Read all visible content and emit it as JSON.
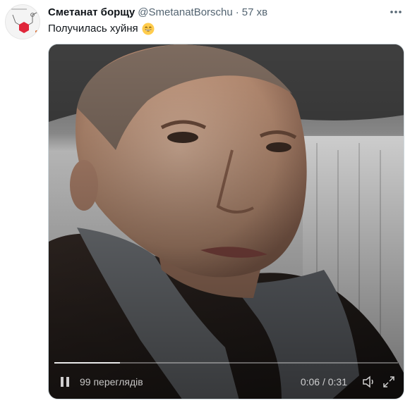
{
  "author": {
    "display_name": "Сметанат борщу",
    "handle": "@SmetanatBorschu",
    "separator": "·",
    "time": "57 хв"
  },
  "tweet": {
    "text": "Получилась хуйня",
    "emoji": "grinning-face-with-smiling-eyes"
  },
  "video": {
    "views": "99 переглядів",
    "timer": "0:06 / 0:31",
    "progress": 0.19
  },
  "colors": {
    "text_primary": "#0f1419",
    "text_secondary": "#536471",
    "avatar_hexagon": "#e0263a"
  }
}
